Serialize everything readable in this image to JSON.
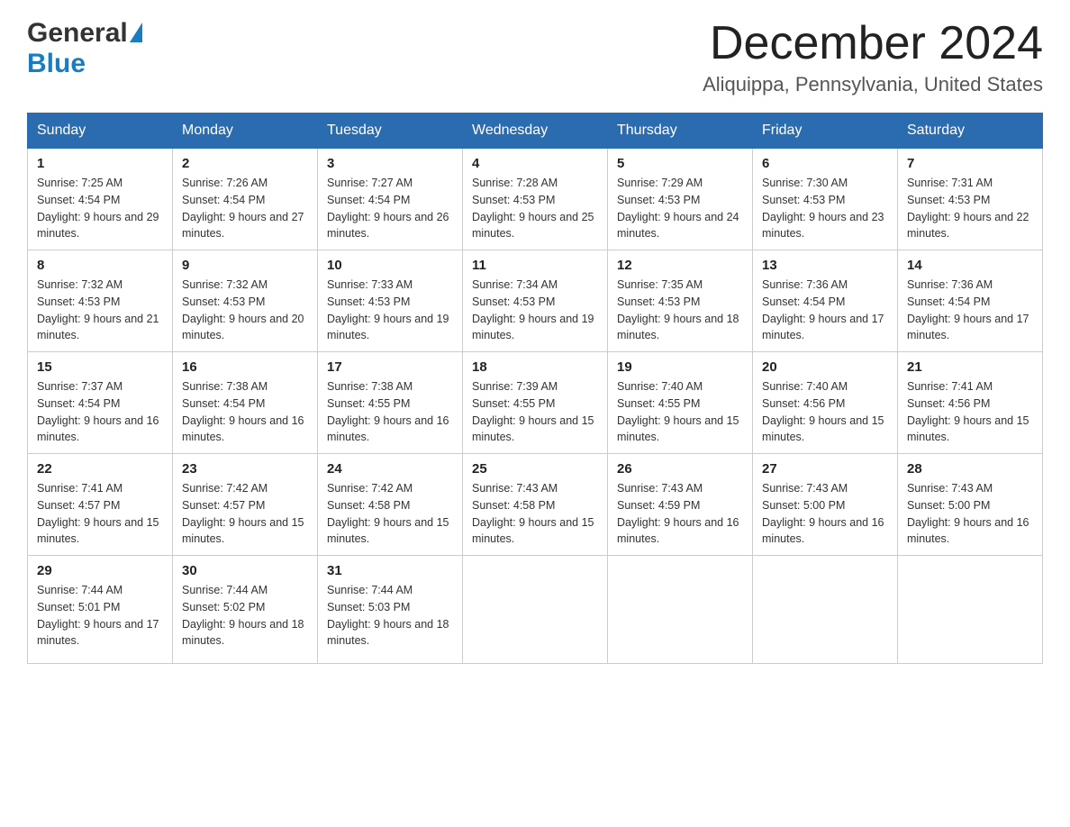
{
  "header": {
    "logo_general": "General",
    "logo_blue": "Blue",
    "month_title": "December 2024",
    "location": "Aliquippa, Pennsylvania, United States"
  },
  "days_of_week": [
    "Sunday",
    "Monday",
    "Tuesday",
    "Wednesday",
    "Thursday",
    "Friday",
    "Saturday"
  ],
  "weeks": [
    [
      {
        "day": "1",
        "sunrise": "7:25 AM",
        "sunset": "4:54 PM",
        "daylight": "9 hours and 29 minutes."
      },
      {
        "day": "2",
        "sunrise": "7:26 AM",
        "sunset": "4:54 PM",
        "daylight": "9 hours and 27 minutes."
      },
      {
        "day": "3",
        "sunrise": "7:27 AM",
        "sunset": "4:54 PM",
        "daylight": "9 hours and 26 minutes."
      },
      {
        "day": "4",
        "sunrise": "7:28 AM",
        "sunset": "4:53 PM",
        "daylight": "9 hours and 25 minutes."
      },
      {
        "day": "5",
        "sunrise": "7:29 AM",
        "sunset": "4:53 PM",
        "daylight": "9 hours and 24 minutes."
      },
      {
        "day": "6",
        "sunrise": "7:30 AM",
        "sunset": "4:53 PM",
        "daylight": "9 hours and 23 minutes."
      },
      {
        "day": "7",
        "sunrise": "7:31 AM",
        "sunset": "4:53 PM",
        "daylight": "9 hours and 22 minutes."
      }
    ],
    [
      {
        "day": "8",
        "sunrise": "7:32 AM",
        "sunset": "4:53 PM",
        "daylight": "9 hours and 21 minutes."
      },
      {
        "day": "9",
        "sunrise": "7:32 AM",
        "sunset": "4:53 PM",
        "daylight": "9 hours and 20 minutes."
      },
      {
        "day": "10",
        "sunrise": "7:33 AM",
        "sunset": "4:53 PM",
        "daylight": "9 hours and 19 minutes."
      },
      {
        "day": "11",
        "sunrise": "7:34 AM",
        "sunset": "4:53 PM",
        "daylight": "9 hours and 19 minutes."
      },
      {
        "day": "12",
        "sunrise": "7:35 AM",
        "sunset": "4:53 PM",
        "daylight": "9 hours and 18 minutes."
      },
      {
        "day": "13",
        "sunrise": "7:36 AM",
        "sunset": "4:54 PM",
        "daylight": "9 hours and 17 minutes."
      },
      {
        "day": "14",
        "sunrise": "7:36 AM",
        "sunset": "4:54 PM",
        "daylight": "9 hours and 17 minutes."
      }
    ],
    [
      {
        "day": "15",
        "sunrise": "7:37 AM",
        "sunset": "4:54 PM",
        "daylight": "9 hours and 16 minutes."
      },
      {
        "day": "16",
        "sunrise": "7:38 AM",
        "sunset": "4:54 PM",
        "daylight": "9 hours and 16 minutes."
      },
      {
        "day": "17",
        "sunrise": "7:38 AM",
        "sunset": "4:55 PM",
        "daylight": "9 hours and 16 minutes."
      },
      {
        "day": "18",
        "sunrise": "7:39 AM",
        "sunset": "4:55 PM",
        "daylight": "9 hours and 15 minutes."
      },
      {
        "day": "19",
        "sunrise": "7:40 AM",
        "sunset": "4:55 PM",
        "daylight": "9 hours and 15 minutes."
      },
      {
        "day": "20",
        "sunrise": "7:40 AM",
        "sunset": "4:56 PM",
        "daylight": "9 hours and 15 minutes."
      },
      {
        "day": "21",
        "sunrise": "7:41 AM",
        "sunset": "4:56 PM",
        "daylight": "9 hours and 15 minutes."
      }
    ],
    [
      {
        "day": "22",
        "sunrise": "7:41 AM",
        "sunset": "4:57 PM",
        "daylight": "9 hours and 15 minutes."
      },
      {
        "day": "23",
        "sunrise": "7:42 AM",
        "sunset": "4:57 PM",
        "daylight": "9 hours and 15 minutes."
      },
      {
        "day": "24",
        "sunrise": "7:42 AM",
        "sunset": "4:58 PM",
        "daylight": "9 hours and 15 minutes."
      },
      {
        "day": "25",
        "sunrise": "7:43 AM",
        "sunset": "4:58 PM",
        "daylight": "9 hours and 15 minutes."
      },
      {
        "day": "26",
        "sunrise": "7:43 AM",
        "sunset": "4:59 PM",
        "daylight": "9 hours and 16 minutes."
      },
      {
        "day": "27",
        "sunrise": "7:43 AM",
        "sunset": "5:00 PM",
        "daylight": "9 hours and 16 minutes."
      },
      {
        "day": "28",
        "sunrise": "7:43 AM",
        "sunset": "5:00 PM",
        "daylight": "9 hours and 16 minutes."
      }
    ],
    [
      {
        "day": "29",
        "sunrise": "7:44 AM",
        "sunset": "5:01 PM",
        "daylight": "9 hours and 17 minutes."
      },
      {
        "day": "30",
        "sunrise": "7:44 AM",
        "sunset": "5:02 PM",
        "daylight": "9 hours and 18 minutes."
      },
      {
        "day": "31",
        "sunrise": "7:44 AM",
        "sunset": "5:03 PM",
        "daylight": "9 hours and 18 minutes."
      },
      null,
      null,
      null,
      null
    ]
  ]
}
